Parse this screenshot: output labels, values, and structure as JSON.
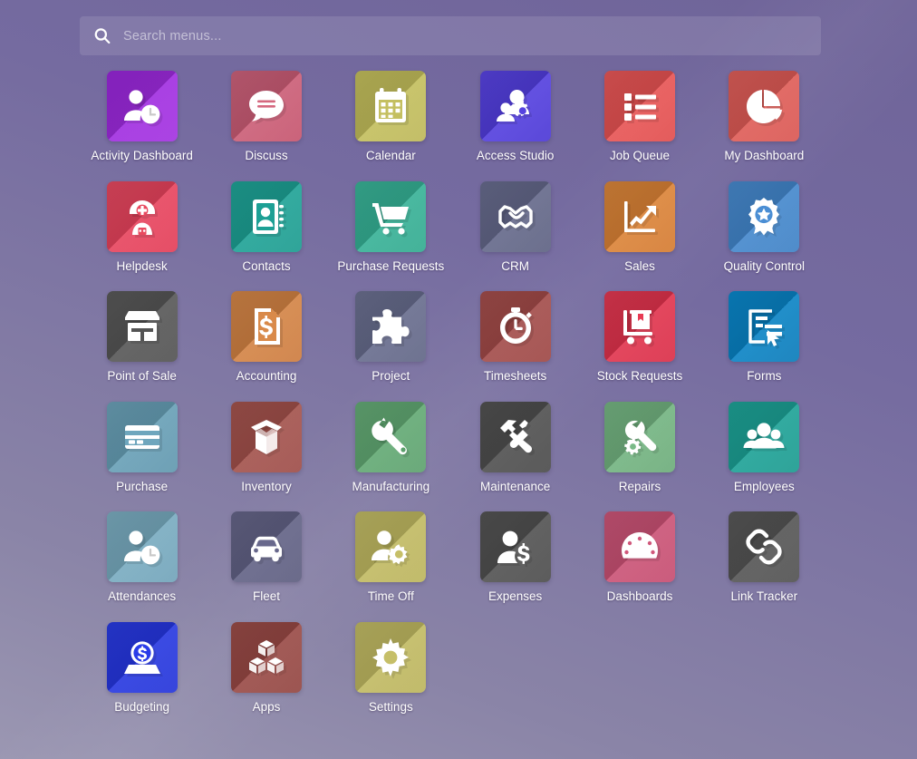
{
  "window": {
    "background_top": "#6f6499",
    "background_bottom": "#9b97b2"
  },
  "search": {
    "placeholder": "Search menus...",
    "value": "",
    "icon": "search-icon"
  },
  "apps": [
    {
      "label": "Activity Dashboard",
      "icon": "user-clock-icon",
      "color": "#a22fe0",
      "color2": "#9c27e0"
    },
    {
      "label": "Discuss",
      "icon": "speech-bubble-icon",
      "color": "#c4526b",
      "color2": "#d1657f"
    },
    {
      "label": "Calendar",
      "icon": "calendar-icon",
      "color": "#bcb757",
      "color2": "#c9c45f"
    },
    {
      "label": "Access Studio",
      "icon": "users-gear-icon",
      "color": "#4834d4",
      "color2": "#5b46e8"
    },
    {
      "label": "Job Queue",
      "icon": "list-blocks-icon",
      "color": "#e04a4a",
      "color2": "#ee5a5a"
    },
    {
      "label": "My Dashboard",
      "icon": "pie-chart-icon",
      "color": "#d9544f",
      "color2": "#e4615c"
    },
    {
      "label": "Helpdesk",
      "icon": "support-agent-icon",
      "color": "#e23a55",
      "color2": "#ec4b63"
    },
    {
      "label": "Contacts",
      "icon": "address-book-icon",
      "color": "#199a8e",
      "color2": "#20a89b"
    },
    {
      "label": "Purchase Requests",
      "icon": "shopping-cart-icon",
      "color": "#2fa98e",
      "color2": "#3bb89c"
    },
    {
      "label": "CRM",
      "icon": "handshake-icon",
      "color": "#5b5f80",
      "color2": "#6b6f92"
    },
    {
      "label": "Sales",
      "icon": "growth-chart-icon",
      "color": "#d4792e",
      "color2": "#e08a3c"
    },
    {
      "label": "Quality Control",
      "icon": "award-ribbon-icon",
      "color": "#3b7fc4",
      "color2": "#4a8ed4"
    },
    {
      "label": "Point of Sale",
      "icon": "storefront-icon",
      "color": "#4f4f4f",
      "color2": "#5c5c5c"
    },
    {
      "label": "Accounting",
      "icon": "invoice-dollar-icon",
      "color": "#cc7a3c",
      "color2": "#d98a4a"
    },
    {
      "label": "Project",
      "icon": "puzzle-piece-icon",
      "color": "#5e6384",
      "color2": "#6e7394"
    },
    {
      "label": "Timesheets",
      "icon": "stopwatch-icon",
      "color": "#9c4442",
      "color2": "#a8504e"
    },
    {
      "label": "Stock Requests",
      "icon": "pallet-truck-icon",
      "color": "#d92a44",
      "color2": "#e83a54"
    },
    {
      "label": "Forms",
      "icon": "form-cursor-icon",
      "color": "#0679b8",
      "color2": "#0a8bd0"
    },
    {
      "label": "Purchase",
      "icon": "credit-card-icon",
      "color": "#5e96ad",
      "color2": "#6ea6bd"
    },
    {
      "label": "Inventory",
      "icon": "open-box-icon",
      "color": "#9c4a45",
      "color2": "#a85650"
    },
    {
      "label": "Manufacturing",
      "icon": "wrench-icon",
      "color": "#5aa06b",
      "color2": "#68b07a"
    },
    {
      "label": "Maintenance",
      "icon": "hammer-screwdriver-icon",
      "color": "#484848",
      "color2": "#545454"
    },
    {
      "label": "Repairs",
      "icon": "wrench-gear-icon",
      "color": "#6aab78",
      "color2": "#79ba87"
    },
    {
      "label": "Employees",
      "icon": "people-group-icon",
      "color": "#17998e",
      "color2": "#1fa89c"
    },
    {
      "label": "Attendances",
      "icon": "user-clock-icon",
      "color": "#6fa2b8",
      "color2": "#7fb2c6"
    },
    {
      "label": "Fleet",
      "icon": "car-icon",
      "color": "#5a5a7d",
      "color2": "#68688c"
    },
    {
      "label": "Time Off",
      "icon": "user-sun-icon",
      "color": "#bab35a",
      "color2": "#c6bf68"
    },
    {
      "label": "Expenses",
      "icon": "user-dollar-icon",
      "color": "#4a4a4a",
      "color2": "#565656"
    },
    {
      "label": "Dashboards",
      "icon": "gauge-icon",
      "color": "#c44a6e",
      "color2": "#d0587b"
    },
    {
      "label": "Link Tracker",
      "icon": "chain-link-icon",
      "color": "#4e4e4e",
      "color2": "#5a5a5a"
    },
    {
      "label": "Budgeting",
      "icon": "coin-deposit-icon",
      "color": "#2030d8",
      "color2": "#2a3ce8"
    },
    {
      "label": "Apps",
      "icon": "cubes-icon",
      "color": "#91423e",
      "color2": "#9e4e4a"
    },
    {
      "label": "Settings",
      "icon": "gear-icon",
      "color": "#bab35a",
      "color2": "#c6bf68"
    }
  ]
}
